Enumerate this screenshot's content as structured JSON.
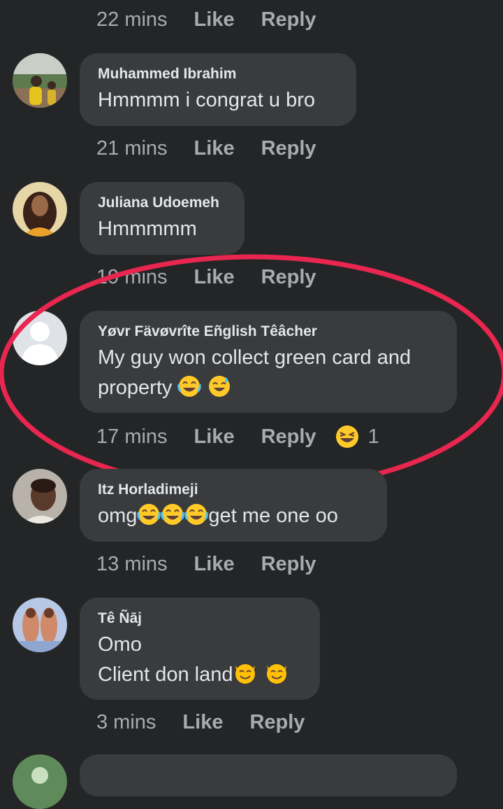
{
  "comments_top_meta": {
    "time": "22 mins",
    "like": "Like",
    "reply": "Reply"
  },
  "comments": [
    {
      "name": "Muhammed Ibrahim",
      "text": "Hmmmm i congrat u bro",
      "time": "21 mins",
      "like": "Like",
      "reply": "Reply"
    },
    {
      "name": "Juliana Udoemeh",
      "text": "Hmmmmm",
      "time": "19 mins",
      "like": "Like",
      "reply": "Reply"
    },
    {
      "name": "Yøvr Fävøvrîte Eñglish Têâcher",
      "text_line1": "My guy won collect green card and",
      "text_line2": "property",
      "time": "17 mins",
      "like": "Like",
      "reply": "Reply",
      "reaction_count": "1",
      "highlighted": true
    },
    {
      "name": "Itz Horladimeji",
      "text_prefix": "omg",
      "text_suffix": "get me one oo",
      "time": "13 mins",
      "like": "Like",
      "reply": "Reply"
    },
    {
      "name": "Tê Ñāj",
      "text_line1": "Omo",
      "text_line2": "Client don land",
      "time": "3 mins",
      "like": "Like",
      "reply": "Reply"
    }
  ],
  "colors": {
    "background": "#242526",
    "bubble": "#3a3b3c",
    "meta_text": "#a8abaf",
    "highlight_ring": "#e8264f"
  },
  "icons": [
    "laughing-tears-emoji",
    "sweat-smile-emoji",
    "laughing-reaction-icon",
    "smiling-cat-emoji",
    "default-avatar-icon"
  ]
}
